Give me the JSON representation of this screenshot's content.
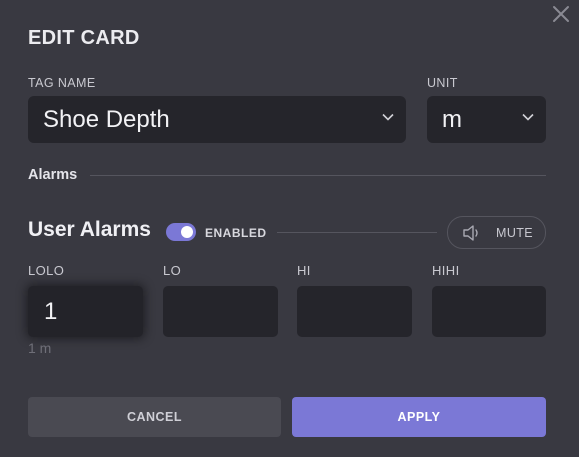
{
  "dialog": {
    "title": "EDIT CARD",
    "close_icon": "close-icon"
  },
  "tag": {
    "label": "TAG NAME",
    "value": "Shoe Depth"
  },
  "unit": {
    "label": "UNIT",
    "value": "m"
  },
  "alarms_section": {
    "title": "Alarms"
  },
  "user_alarms": {
    "title": "User Alarms",
    "toggle_state": "on",
    "toggle_label": "ENABLED",
    "mute_label": "MUTE",
    "mute_icon": "speaker-icon"
  },
  "fields": [
    {
      "label": "LOLO",
      "value": "1"
    },
    {
      "label": "LO",
      "value": ""
    },
    {
      "label": "HI",
      "value": ""
    },
    {
      "label": "HIHI",
      "value": ""
    }
  ],
  "hint": "1 m",
  "buttons": {
    "cancel": "CANCEL",
    "apply": "APPLY"
  },
  "colors": {
    "background": "#393941",
    "field_bg": "#25252b",
    "accent": "#7b78d6",
    "cancel_bg": "#4a4a52"
  }
}
